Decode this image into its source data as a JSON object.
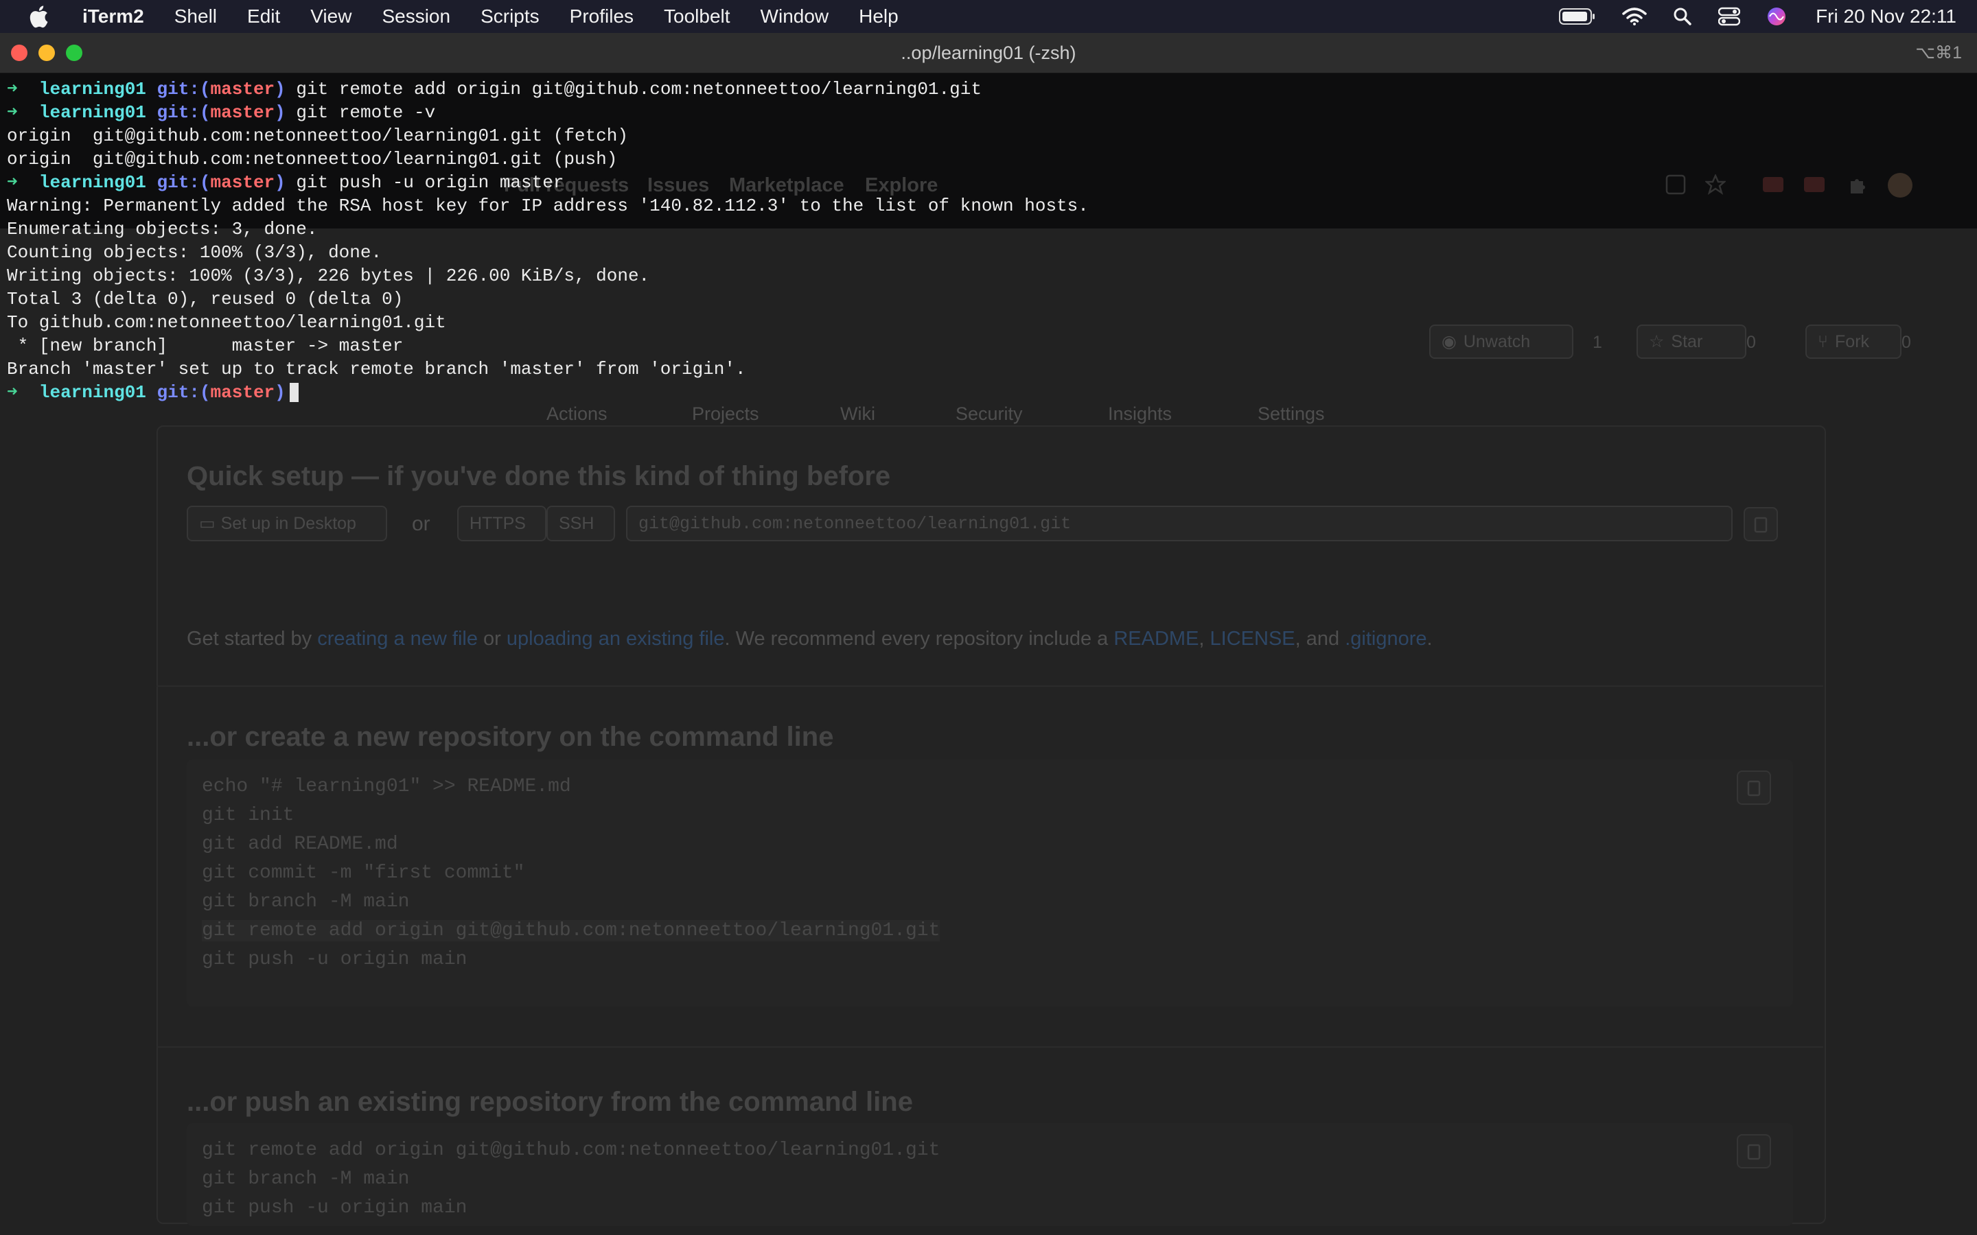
{
  "menubar": {
    "app_name": "iTerm2",
    "items": [
      "Shell",
      "Edit",
      "View",
      "Session",
      "Scripts",
      "Profiles",
      "Toolbelt",
      "Window",
      "Help"
    ],
    "clock": "Fri 20 Nov  22:11",
    "status_icons": [
      "battery-icon",
      "wifi-icon",
      "spotlight-search-icon",
      "control-center-icon",
      "siri-icon"
    ]
  },
  "window": {
    "title": "..op/learning01 (-zsh)",
    "shortcut": "⌥⌘1"
  },
  "terminal": {
    "prompt_arrow": "➜",
    "prompt_dir": "learning01",
    "prompt_git": "git:(",
    "prompt_branch": "master",
    "prompt_close": ")",
    "commands": [
      "git remote add origin git@github.com:netonneettoo/learning01.git",
      "git remote -v",
      "git push -u origin master"
    ],
    "output_remote": [
      "origin  git@github.com:netonneettoo/learning01.git (fetch)",
      "origin  git@github.com:netonneettoo/learning01.git (push)"
    ],
    "output_push": [
      "Warning: Permanently added the RSA host key for IP address '140.82.112.3' to the list of known hosts.",
      "Enumerating objects: 3, done.",
      "Counting objects: 100% (3/3), done.",
      "Writing objects: 100% (3/3), 226 bytes | 226.00 KiB/s, done.",
      "Total 3 (delta 0), reused 0 (delta 0)",
      "To github.com:netonneettoo/learning01.git",
      " * [new branch]      master -> master",
      "Branch 'master' set up to track remote branch 'master' from 'origin'."
    ]
  },
  "background_page": {
    "nav": [
      "Pull requests",
      "Issues",
      "Marketplace",
      "Explore"
    ],
    "repo_actions": {
      "unwatch": "Unwatch",
      "unwatch_count": "1",
      "star": "Star",
      "star_count": "0",
      "fork": "Fork",
      "fork_count": "0"
    },
    "tabs": [
      "Actions",
      "Projects",
      "Wiki",
      "Security",
      "Insights",
      "Settings"
    ],
    "quick_setup": {
      "heading": "Quick setup — if you've done this kind of thing before",
      "desktop_button": "Set up in Desktop",
      "or": "or",
      "https": "HTTPS",
      "ssh": "SSH",
      "url": "git@github.com:netonneettoo/learning01.git",
      "help_prefix": "Get started by",
      "link_new_file": "creating a new file",
      "help_or": "or",
      "link_upload": "uploading an existing file",
      "help_mid": ". We recommend every repository include a",
      "link_readme": "README",
      "link_license": "LICENSE",
      "help_and": ", and",
      "link_gitignore": ".gitignore",
      "help_end": "."
    },
    "create_section": {
      "heading": "...or create a new repository on the command line",
      "lines": [
        "echo \"# learning01\" >> README.md",
        "git init",
        "git add README.md",
        "git commit -m \"first commit\"",
        "git branch -M main",
        "git remote add origin git@github.com:netonneettoo/learning01.git",
        "git push -u origin main"
      ]
    },
    "push_section": {
      "heading": "...or push an existing repository from the command line",
      "lines": [
        "git remote add origin git@github.com:netonneettoo/learning01.git",
        "git branch -M main",
        "git push -u origin main"
      ]
    }
  }
}
